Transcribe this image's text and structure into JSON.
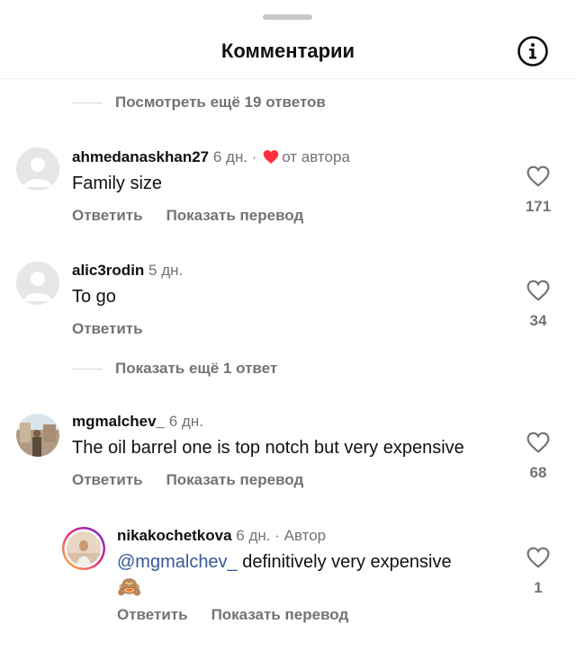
{
  "header": {
    "title": "Комментарии"
  },
  "view_more_top": "Посмотреть ещё 19 ответов",
  "show_more_mid": "Показать ещё 1 ответ",
  "actions": {
    "reply": "Ответить",
    "translate": "Показать перевод"
  },
  "comments": [
    {
      "username": "ahmedanaskhan27",
      "time": "6 дн. ·",
      "badge": "от автора",
      "text": "Family size",
      "likes": "171"
    },
    {
      "username": "alic3rodin",
      "time": "5 дн.",
      "text": "To go",
      "likes": "34"
    },
    {
      "username": "mgmalchev_",
      "time": "6 дн.",
      "text": "The oil barrel one is top notch but very expensive",
      "likes": "68"
    },
    {
      "username": "nikakochetkova",
      "time": "6 дн. · Автор",
      "mention": "@mgmalchev_",
      "text": " definitively very expensive",
      "emoji": "🙈",
      "likes": "1"
    }
  ],
  "colors": {
    "liked_heart": "#ff3040",
    "mention": "#385898",
    "story_ring": [
      "#f9ce34",
      "#ee2a7b",
      "#6228d7"
    ]
  }
}
